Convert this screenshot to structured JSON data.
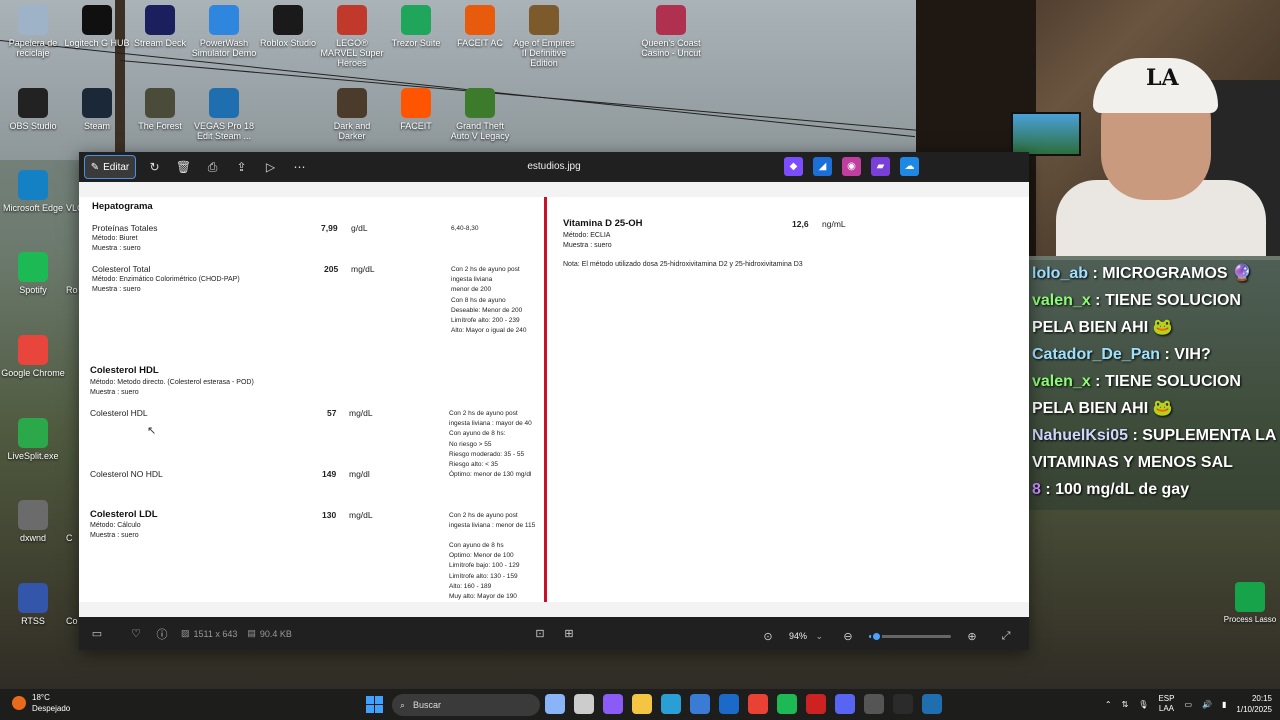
{
  "desktop": {
    "icons": [
      {
        "label": "Papelera de reciclaje",
        "color": "#9fb3c8"
      },
      {
        "label": "Logitech G HUB",
        "color": "#101010"
      },
      {
        "label": "Stream Deck",
        "color": "#1b1f5e"
      },
      {
        "label": "PowerWash Simulator Demo",
        "color": "#2e86de"
      },
      {
        "label": "Roblox Studio",
        "color": "#1a1a1a"
      },
      {
        "label": "LEGO® MARVEL Super Heroes",
        "color": "#c0392b"
      },
      {
        "label": "Trezor Suite",
        "color": "#1fa65a"
      },
      {
        "label": "FACEIT AC",
        "color": "#e85a0c"
      },
      {
        "label": "Age of Empires II Definitive Edition",
        "color": "#7d5a2c"
      },
      {
        "label": "Queen's Coast Casino - Uncut",
        "color": "#b03050"
      },
      {
        "label": "OBS Studio",
        "color": "#222222"
      },
      {
        "label": "Steam",
        "color": "#1b2838"
      },
      {
        "label": "The Forest",
        "color": "#4b4b3a"
      },
      {
        "label": "VEGAS Pro 18 Edit Steam ...",
        "color": "#1f6fb0"
      },
      {
        "label": "Dark and Darker",
        "color": "#4a3b2b"
      },
      {
        "label": "FACEIT",
        "color": "#ff5500"
      },
      {
        "label": "Grand Theft Auto V Legacy",
        "color": "#3c7a2c"
      },
      {
        "label": "Microsoft Edge",
        "color": "#1581c5"
      },
      {
        "label": "VLC",
        "color": "#ff8800"
      },
      {
        "label": "Spotify",
        "color": "#1db954"
      },
      {
        "label": "Ro",
        "color": "#444444"
      },
      {
        "label": "Google Chrome",
        "color": "#e8453c"
      },
      {
        "label": "LiveSplit.exe",
        "color": "#2aa84a"
      },
      {
        "label": "dxwnd",
        "color": "#6b6b6b"
      },
      {
        "label": "C",
        "color": "#444444"
      },
      {
        "label": "RTSS",
        "color": "#3355aa"
      },
      {
        "label": "Co",
        "color": "#444444"
      }
    ]
  },
  "viewer": {
    "toolbar": {
      "edit_label": "Editar",
      "file_name": "estudios.jpg"
    },
    "document": {
      "hepatograma_title": "Hepatograma",
      "proteinas_label": "Proteínas Totales",
      "proteinas_method": "Método: Biuret",
      "proteinas_sample": "Muestra : suero",
      "proteinas_value": "7,99",
      "proteinas_unit": "g/dL",
      "proteinas_ref": "6,40-8,30",
      "colesterol_total_label": "Colesterol Total",
      "colesterol_total_method": "Método: Enzimático Colorimétrico (CHOD-PAP)",
      "colesterol_total_sample": "Muestra : suero",
      "colesterol_total_value": "205",
      "colesterol_total_unit": "mg/dL",
      "colesterol_total_ref": [
        "Con 2 hs de ayuno post",
        " ingesta liviana",
        " menor de 200",
        " Con 8 hs de ayuno",
        " Deseable: Menor de 200",
        " Limítrofe alto: 200 - 239",
        " Alto: Mayor o igual de 240"
      ],
      "hdl_section_title": "Colesterol HDL",
      "hdl_method": "Método: Metodo  directo. (Colesterol esterasa - POD)",
      "hdl_sample": "Muestra : suero",
      "hdl_label": "Colesterol HDL",
      "hdl_value": "57",
      "hdl_unit": "mg/dL",
      "hdl_ref": [
        "Con 2 hs de ayuno post",
        " ingesta liviana : mayor de 40",
        " Con ayuno de 8 hs:",
        " No riesgo > 55",
        " Riesgo moderado: 35 - 55",
        " Riesgo alto: < 35"
      ],
      "no_hdl_label": "Colesterol NO HDL",
      "no_hdl_value": "149",
      "no_hdl_unit": "mg/dl",
      "no_hdl_ref": "Óptimo: menor de 130 mg/dl",
      "ldl_section_title": "Colesterol LDL",
      "ldl_method": "Método: Cálculo",
      "ldl_sample": "Muestra : suero",
      "ldl_value": "130",
      "ldl_unit": "mg/dL",
      "ldl_ref_a": [
        "Con 2 hs de ayuno post",
        " ingesta liviana : menor de 115"
      ],
      "ldl_ref_b": [
        "Con ayuno de 8 hs",
        " Optimo: Menor de 100",
        " Limítrofe bajo: 100 - 129",
        " Limítrofe alto: 130 - 159",
        " Alto: 160 - 189",
        " Muy alto: Mayor de 190"
      ],
      "vitd_label": "Vitamina D 25-OH",
      "vitd_method": "Método: ECLIA",
      "vitd_sample": "Muestra : suero",
      "vitd_value": "12,6",
      "vitd_unit": "ng/mL",
      "vitd_note": "Nota: El método utilizado dosa 25-hidroxivitamina D2 y 25-hidroxivitamina D3"
    },
    "bottombar": {
      "dimensions": "1511 x 643",
      "file_size": "90.4 KB",
      "zoom_level": "94%",
      "zoom_fraction": 0.08
    }
  },
  "chat": {
    "messages": [
      {
        "user": "lolo_ab",
        "text": " : MICROGRAMOS 🔮",
        "style": ""
      },
      {
        "user": "valen_x",
        "text": " : TIENE SOLUCION PELA BIEN AHI 🐸",
        "style": "green"
      },
      {
        "user": "Catador_De_Pan",
        "text": " : VIH?",
        "style": ""
      },
      {
        "user": "valen_x",
        "text": " : TIENE SOLUCION PELA BIEN AHI 🐸",
        "style": "green"
      },
      {
        "user": "NahuelKsi05",
        "text": " : SUPLEMENTA LA VITAMINAS Y MENOS SAL",
        "style": "gray"
      },
      {
        "user": "8",
        "text": " : 100 mg/dL de gay",
        "style": "purple"
      }
    ]
  },
  "process_lasso_label": "Process Lasso",
  "taskbar": {
    "weather_temp": "18°C",
    "weather_desc": "Despejado",
    "search_placeholder": "Buscar",
    "lang_top": "ESP",
    "lang_bottom": "LAA",
    "time": "20:15",
    "date": "1/10/2025",
    "apps": [
      "#8ab4f8",
      "#cccccc",
      "#8a5cf5",
      "#f4c542",
      "#2a9fd6",
      "#3a7bd5",
      "#1b6ac9",
      "#e94235",
      "#1db954",
      "#cc2222",
      "#5865f2",
      "#555555",
      "#2b2b2b",
      "#1f6fb0"
    ]
  }
}
